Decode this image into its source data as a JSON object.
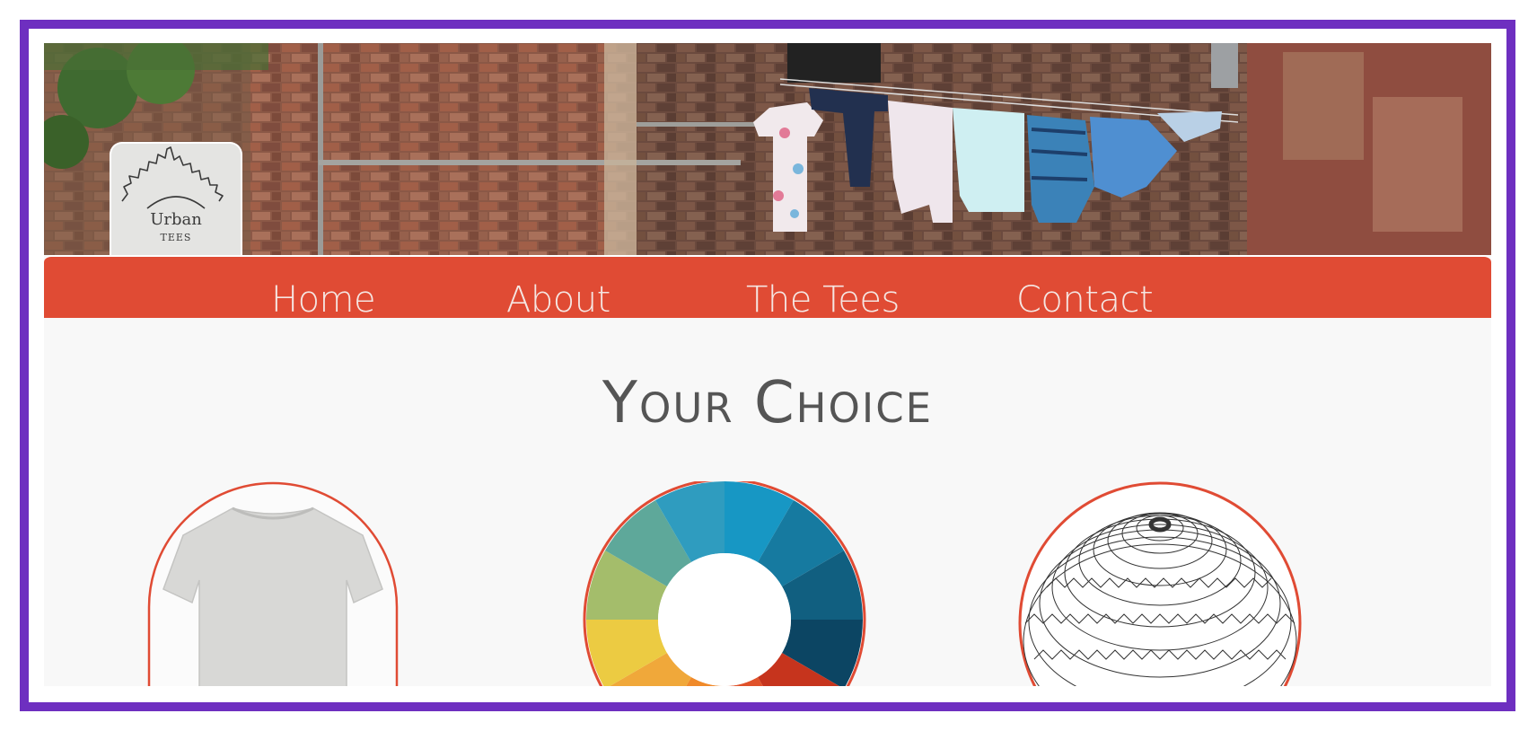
{
  "logo": {
    "name": "Urban",
    "tagline": "TEES"
  },
  "nav": {
    "items": [
      {
        "label": "Home"
      },
      {
        "label": "About"
      },
      {
        "label": "The Tees"
      },
      {
        "label": "Contact"
      }
    ]
  },
  "main": {
    "heading": "Your Choice"
  },
  "colors": {
    "frame": "#6e2fc0",
    "accent": "#e04b34",
    "text": "#555555"
  },
  "cards": [
    {
      "icon": "tshirt-icon"
    },
    {
      "icon": "color-wheel-icon"
    },
    {
      "icon": "pattern-sphere-icon"
    }
  ]
}
